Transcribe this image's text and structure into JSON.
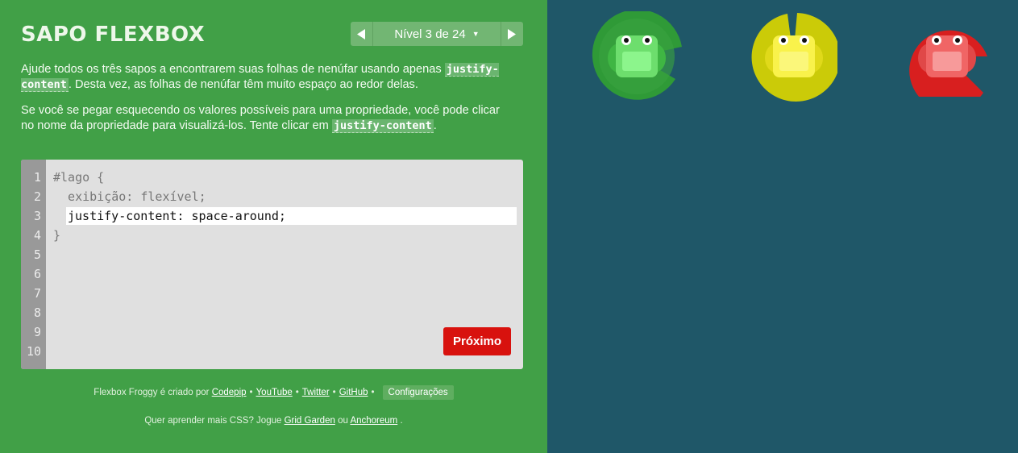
{
  "app": {
    "title": "SAPO FLEXBOX"
  },
  "level_nav": {
    "label": "Nível 3 de 24",
    "prev_icon": "triangle-left-icon",
    "next_icon": "triangle-right-icon",
    "caret_icon": "caret-down-icon"
  },
  "instructions": {
    "p1_before": "Ajude todos os três sapos a encontrarem suas folhas de nenúfar usando apenas ",
    "p1_code": "justify-content",
    "p1_after": ". Desta vez, as folhas de nenúfar têm muito espaço ao redor delas.",
    "p2_before": "Se você se pegar esquecendo os valores possíveis para uma propriedade, você pode clicar no nome da propriedade para visualizá-los. Tente clicar em ",
    "p2_code": "justify-content",
    "p2_after": "."
  },
  "editor": {
    "line_numbers": [
      "1",
      "2",
      "3",
      "4",
      "5",
      "6",
      "7",
      "8",
      "9",
      "10"
    ],
    "line1": "#lago {",
    "line2": "  exibição: flexível;",
    "input_value": "justify-content: space-around;",
    "line4": "}",
    "next_button": "Próximo"
  },
  "credits": {
    "made_by": "Flexbox Froggy é criado por",
    "codepip": "Codepip",
    "youtube": "YouTube",
    "twitter": "Twitter",
    "github": "GitHub",
    "bullet": "•",
    "settings": "Configurações",
    "more_prefix": "Quer aprender mais CSS? Jogue",
    "grid_garden": "Grid Garden",
    "or": "ou",
    "anchoreum": "Anchoreum",
    "period": "."
  },
  "colors": {
    "sidebar_bg": "#41a047",
    "board_bg": "#1f5768",
    "next_button": "#d8120e",
    "green_frog": "#6dde6d",
    "yellow_frog": "#f9f24b",
    "red_frog": "#f06565",
    "green_pad": "#2f9a37",
    "yellow_pad": "#cbcb08",
    "red_pad": "#d81f1f"
  },
  "board": {
    "frogs": [
      {
        "color": "green",
        "pad": "lilypad-green"
      },
      {
        "color": "yellow",
        "pad": "lilypad-yellow"
      },
      {
        "color": "red",
        "pad": "lilypad-red"
      }
    ]
  }
}
